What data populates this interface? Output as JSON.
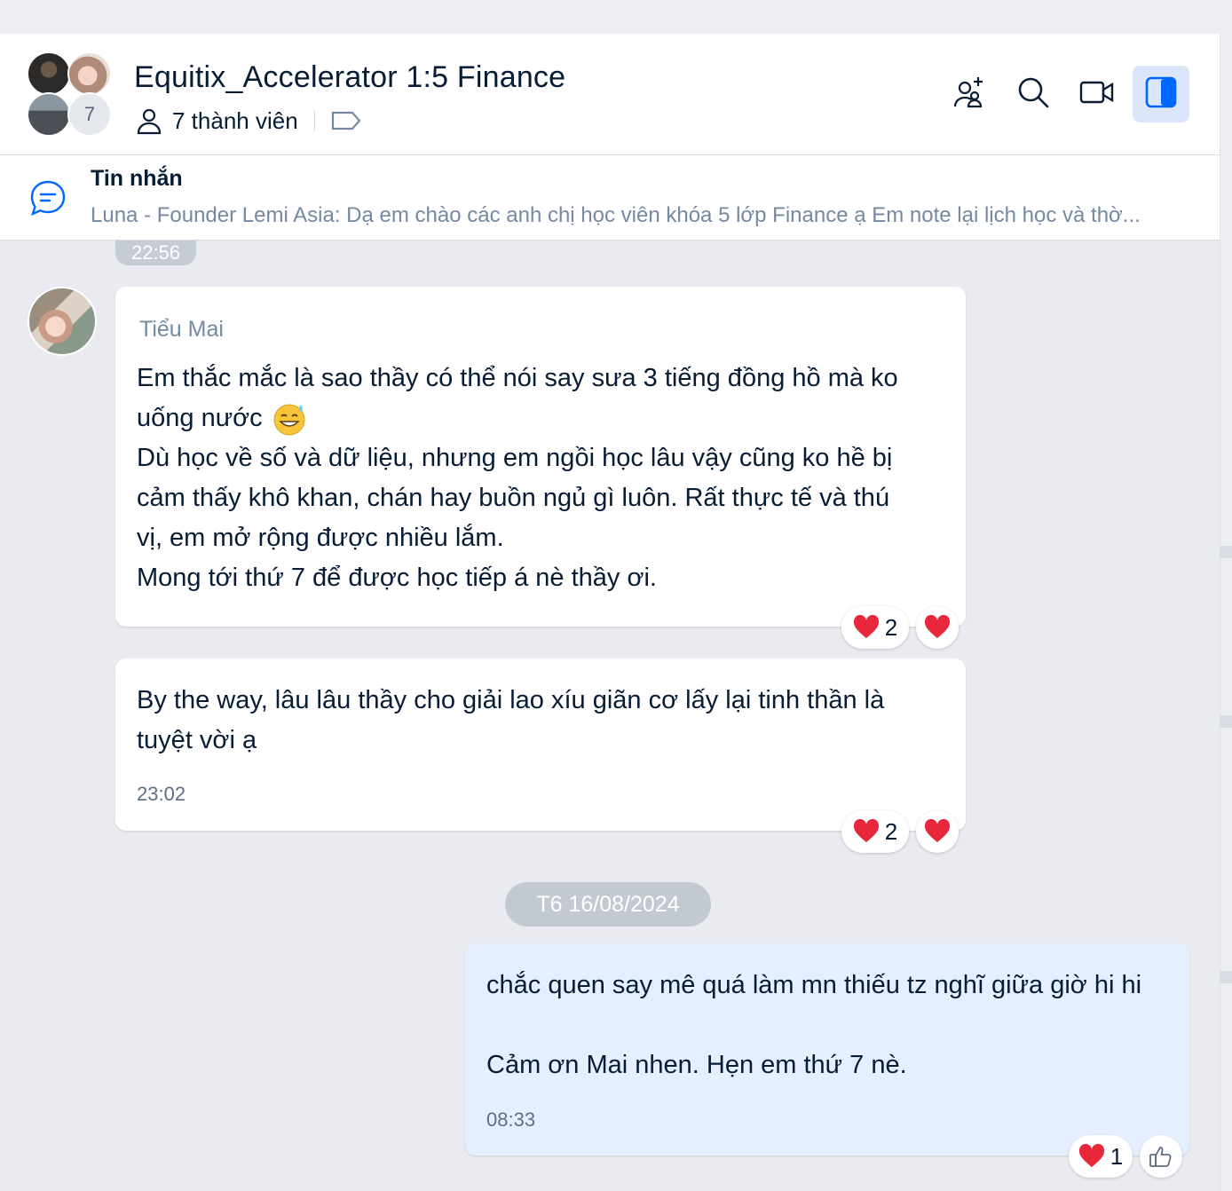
{
  "header": {
    "title": "Equitix_Accelerator 1:5 Finance",
    "member_count_badge": "7",
    "members_label": "7 thành viên"
  },
  "pinned": {
    "title": "Tin nhắn",
    "preview": "Luna - Founder Lemi Asia: Dạ em chào các anh chị học viên khóa 5 lớp Finance ạ  Em note lại lịch học và thờ..."
  },
  "messages": [
    {
      "sender": "Tiểu Mai",
      "lines": [
        "Em thắc mắc là sao thầy có thể nói say sưa 3 tiếng đồng hồ mà ko",
        "uống nước",
        "Dù học về số và dữ liệu, nhưng em ngồi học lâu vậy cũng ko hề bị",
        "cảm thấy khô khan, chán hay buồn ngủ gì luôn. Rất thực tế và thú",
        "vị, em mở rộng được nhiều lắm.",
        "Mong tới thứ 7 để được học tiếp á nè thầy ơi."
      ],
      "previous_time": "22:56",
      "reaction_count": "2"
    },
    {
      "lines": [
        "By the way, lâu lâu thầy cho giải lao xíu giãn cơ lấy lại tinh thần là",
        "tuyệt vời ạ"
      ],
      "time": "23:02",
      "reaction_count": "2"
    },
    {
      "date_divider": "T6 16/08/2024",
      "lines": [
        "chắc quen say mê quá làm mn thiếu tz nghĩ giữa giờ hi hi",
        "",
        "Cảm ơn Mai nhen. Hẹn em thứ 7 nè."
      ],
      "time": "08:33",
      "reaction_count": "1"
    }
  ],
  "icons": {
    "add_member": "add-user-icon",
    "search": "search-icon",
    "video": "video-call-icon",
    "sidebar": "sidebar-toggle-icon",
    "pinned": "chat-bubble-icon",
    "members": "person-icon",
    "tag": "tag-icon"
  },
  "colors": {
    "accent": "#0068ff",
    "mine_bubble": "#e5efff",
    "heart": "#e8283a"
  }
}
